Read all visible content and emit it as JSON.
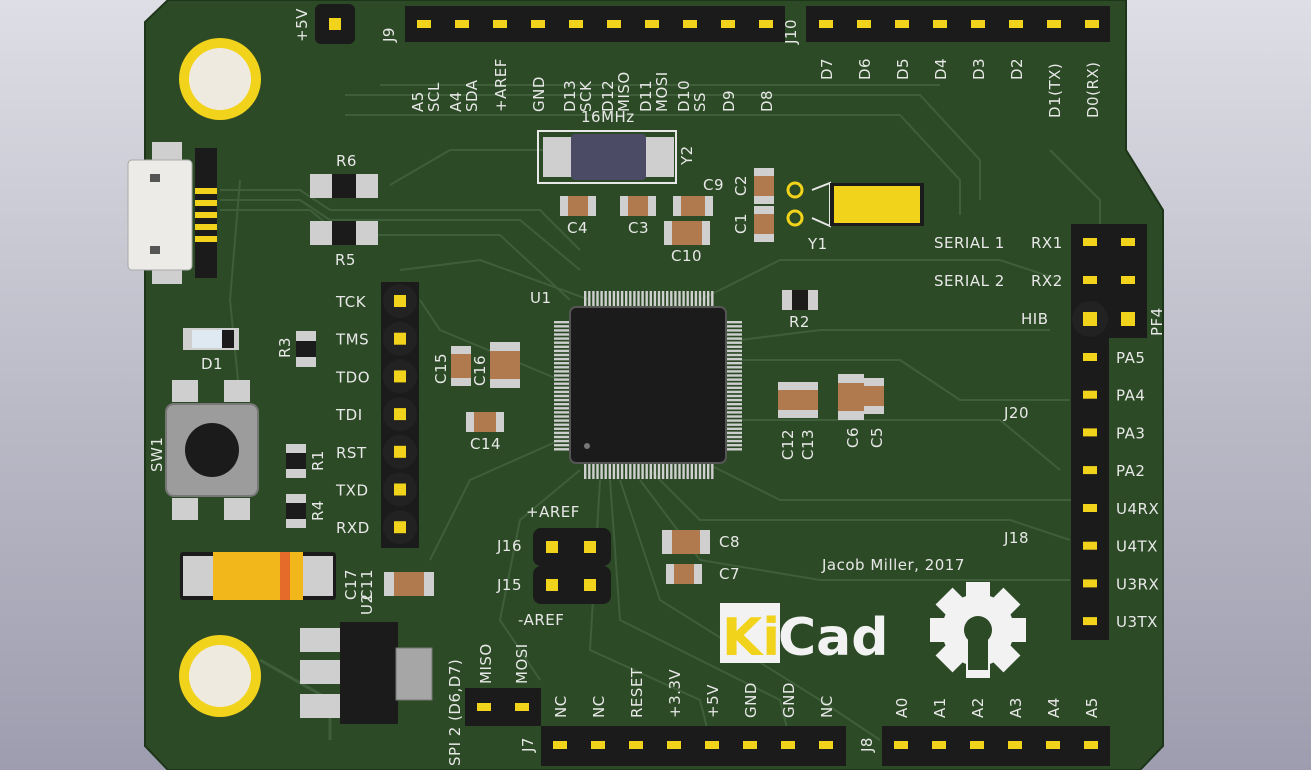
{
  "board": {
    "author": "Jacob Miller, 2017",
    "power_top": "+5V",
    "colors": {
      "pcb": "#2c4a25",
      "silkscreen": "#e8e8e8",
      "gold": "#f2d31b",
      "header": "#1b1b1b"
    }
  },
  "headers": {
    "j9": {
      "ref": "J9",
      "pins": [
        "A5 SCL",
        "A4 SDA",
        "+AREF",
        "GND",
        "D13 SCK",
        "D12 MISO",
        "D11 MOSI",
        "D10 SS",
        "D9",
        "D8"
      ]
    },
    "j10": {
      "ref": "J10",
      "pins": [
        "D7",
        "D6",
        "D5",
        "D4",
        "D3",
        "D2",
        "D1(TX)",
        "D0(RX)"
      ]
    },
    "j7": {
      "ref": "J7",
      "pins": [
        "NC",
        "NC",
        "RESET",
        "+3.3V",
        "+5V",
        "GND",
        "GND",
        "NC"
      ]
    },
    "j8": {
      "ref": "J8",
      "pins": [
        "A0",
        "A1",
        "A2",
        "A3",
        "A4",
        "A5"
      ]
    },
    "spi2": {
      "label": "SPI 2 (D6,D7)",
      "pins": [
        "MISO",
        "MOSI"
      ]
    },
    "jtag": {
      "pins": [
        "TCK",
        "TMS",
        "TDO",
        "TDI",
        "RST",
        "TXD",
        "RXD"
      ]
    },
    "j20": {
      "ref": "J20",
      "rows": [
        "SERIAL 1",
        "SERIAL 2"
      ],
      "pins": [
        "RX1",
        "RX2",
        "HIB",
        "PF4",
        "PA5",
        "PA4",
        "PA3",
        "PA2"
      ]
    },
    "j18": {
      "ref": "J18",
      "pins": [
        "U4RX",
        "U4TX",
        "U3RX",
        "U3TX"
      ]
    },
    "aref": {
      "plus": "+AREF",
      "minus": "-AREF",
      "j16": "J16",
      "j15": "J15"
    }
  },
  "components": {
    "crystal": "16MHz",
    "y2": "Y2",
    "y1": "Y1",
    "u1": "U1",
    "u2": "U2",
    "sw1": "SW1",
    "d1": "D1",
    "r6": "R6",
    "r5": "R5",
    "r3": "R3",
    "r1": "R1",
    "r4": "R4",
    "r2": "R2",
    "c4": "C4",
    "c3": "C3",
    "c10": "C10",
    "c9": "C9",
    "c2": "C2",
    "c1": "C1",
    "c15": "C15",
    "c16": "C16",
    "c14": "C14",
    "c12": "C12",
    "c13": "C13",
    "c6": "C6",
    "c5": "C5",
    "c8": "C8",
    "c7": "C7",
    "c17": "C17",
    "c11": "C11"
  },
  "logos": {
    "kicad_ki": "Ki",
    "kicad_cad": "Cad",
    "oshw": "gear-icon"
  }
}
